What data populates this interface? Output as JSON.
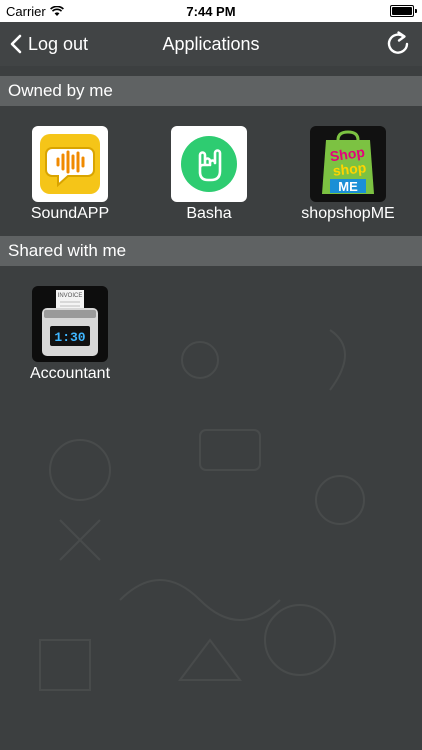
{
  "status": {
    "carrier": "Carrier",
    "time": "7:44 PM"
  },
  "nav": {
    "back_label": "Log out",
    "title": "Applications"
  },
  "sections": {
    "owned": {
      "title": "Owned by me",
      "apps": [
        {
          "label": "SoundAPP",
          "icon": "soundapp-icon"
        },
        {
          "label": "Basha",
          "icon": "basha-icon"
        },
        {
          "label": "shopshopME",
          "icon": "shopshopme-icon"
        }
      ]
    },
    "shared": {
      "title": "Shared with me",
      "apps": [
        {
          "label": "Accountant",
          "icon": "accountant-icon"
        }
      ]
    }
  },
  "icon_text": {
    "shop_lines": [
      "Shop",
      "shop",
      "ME"
    ],
    "invoice": "INVOICE",
    "display": "1:30"
  },
  "colors": {
    "background": "#3c3f40",
    "nav": "#414445",
    "section_header": "#5f6263",
    "basha_green": "#2ecc71",
    "soundapp_yellow": "#f5c518"
  }
}
